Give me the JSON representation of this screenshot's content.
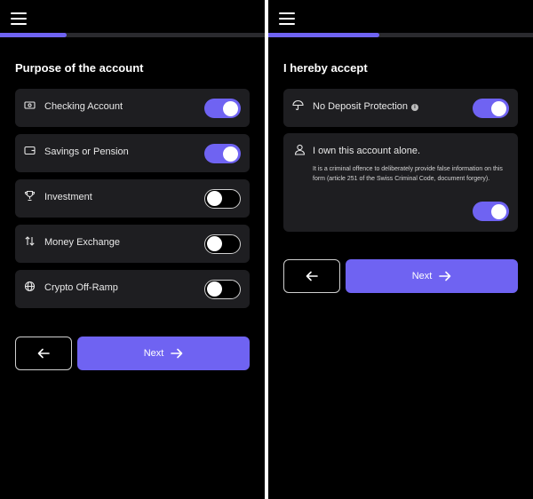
{
  "colors": {
    "accent": "#6f63f2",
    "background": "#000000",
    "card": "#1e1e21",
    "divider": "#ffffff"
  },
  "left_screen": {
    "progress": 0.25,
    "title": "Purpose of the account",
    "options": [
      {
        "icon": "banknote-icon",
        "label": "Checking Account",
        "enabled": true
      },
      {
        "icon": "wallet-icon",
        "label": "Savings or Pension",
        "enabled": true
      },
      {
        "icon": "trophy-icon",
        "label": "Investment",
        "enabled": false
      },
      {
        "icon": "exchange-arrows-icon",
        "label": "Money Exchange",
        "enabled": false
      },
      {
        "icon": "globe-icon",
        "label": "Crypto Off-Ramp",
        "enabled": false
      }
    ],
    "back_icon": "arrow-left-icon",
    "next_label": "Next",
    "next_icon": "arrow-right-icon"
  },
  "right_screen": {
    "progress": 0.42,
    "title": "I hereby accept",
    "deposit": {
      "icon": "umbrella-icon",
      "label": "No Deposit Protection",
      "info_icon": "info-icon",
      "enabled": true
    },
    "owner": {
      "icon": "user-icon",
      "title": "I own this account alone.",
      "description": "It is a criminal offence to deliberately provide false information on this form (article 251 of the Swiss Criminal Code, document forgery).",
      "enabled": true
    },
    "back_icon": "arrow-left-icon",
    "next_label": "Next",
    "next_icon": "arrow-right-icon"
  }
}
